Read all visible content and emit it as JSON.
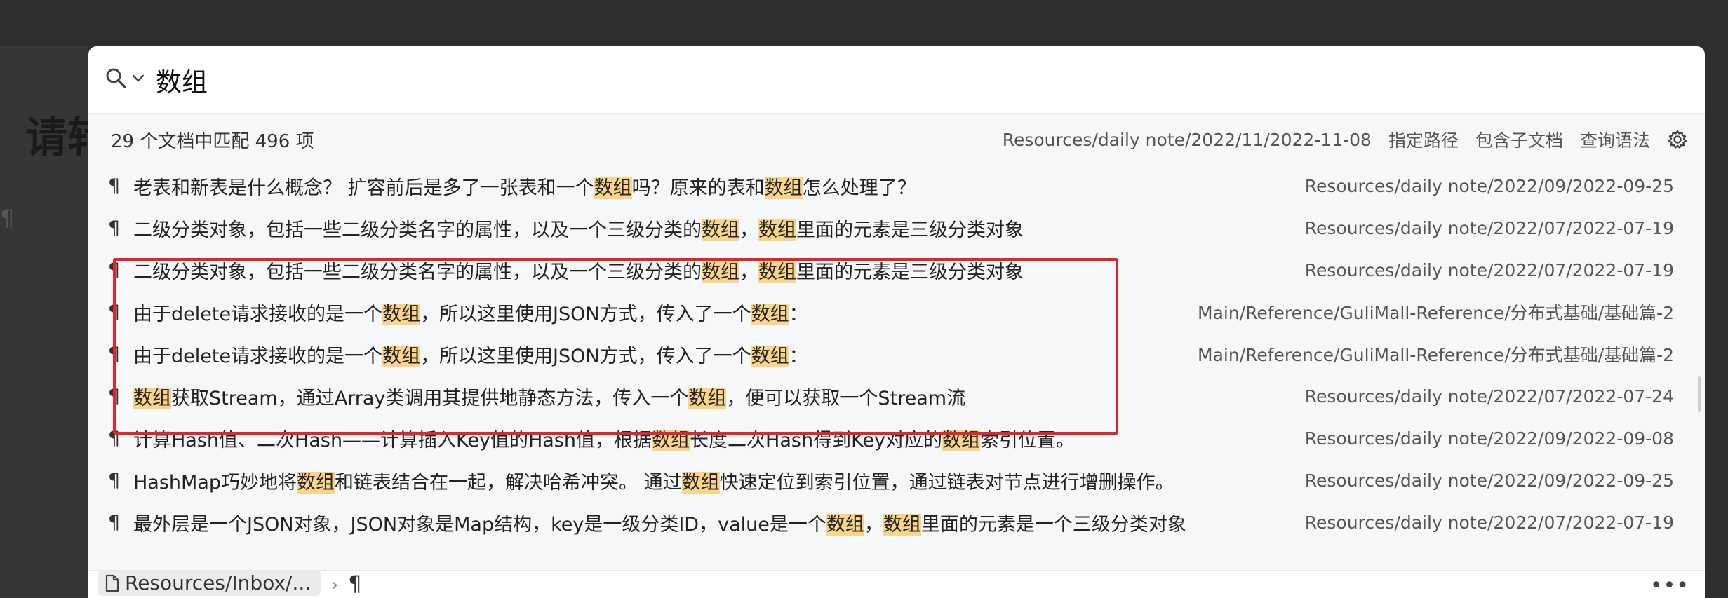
{
  "background": {
    "heading": "请转",
    "pilcrow": "¶"
  },
  "search": {
    "query": "数组"
  },
  "summary": {
    "count_text": "29 个文档中匹配 496 项",
    "current_path": "Resources/daily note/2022/11/2022-11-08",
    "opt_path": "指定路径",
    "opt_subdoc": "包含子文档",
    "opt_syntax": "查询语法"
  },
  "results": [
    {
      "parts": [
        "老表和新表是什么概念？ 扩容前后是多了一张表和一个",
        "*数组",
        "吗？原来的表和",
        "*数组",
        "怎么处理了？"
      ],
      "path": "Resources/daily note/2022/09/2022-09-25"
    },
    {
      "parts": [
        "二级分类对象，包括一些二级分类名字的属性，以及一个三级分类的",
        "*数组",
        "，",
        "*数组",
        "里面的元素是三级分类对象"
      ],
      "path": "Resources/daily note/2022/07/2022-07-19"
    },
    {
      "parts": [
        "二级分类对象，包括一些二级分类名字的属性，以及一个三级分类的",
        "*数组",
        "，",
        "*数组",
        "里面的元素是三级分类对象"
      ],
      "path": "Resources/daily note/2022/07/2022-07-19"
    },
    {
      "parts": [
        "由于delete请求接收的是一个",
        "*数组",
        "，所以这里使用JSON方式，传入了一个",
        "*数组",
        "："
      ],
      "path": "Main/Reference/GuliMall-Reference/分布式基础/基础篇-2"
    },
    {
      "parts": [
        "由于delete请求接收的是一个",
        "*数组",
        "，所以这里使用JSON方式，传入了一个",
        "*数组",
        "："
      ],
      "path": "Main/Reference/GuliMall-Reference/分布式基础/基础篇-2"
    },
    {
      "parts": [
        "*数组",
        "获取Stream，通过Array类调用其提供地静态方法，传入一个",
        "*数组",
        "，便可以获取一个Stream流"
      ],
      "path": "Resources/daily note/2022/07/2022-07-24"
    },
    {
      "parts": [
        "计算Hash值、二次Hash——计算插入Key值的Hash值，根据",
        "*数组",
        "长度二次Hash得到Key对应的",
        "*数组",
        "索引位置。"
      ],
      "path": "Resources/daily note/2022/09/2022-09-08"
    },
    {
      "parts": [
        "HashMap巧妙地将",
        "*数组",
        "和链表结合在一起，解决哈希冲突。 通过",
        "*数组",
        "快速定位到索引位置，通过链表对节点进行增删操作。"
      ],
      "path": "Resources/daily note/2022/09/2022-09-25"
    },
    {
      "parts": [
        "最外层是一个JSON对象，JSON对象是Map结构，key是一级分类ID，value是一个",
        "*数组",
        "，",
        "*数组",
        "里面的元素是一个三级分类对象"
      ],
      "path": "Resources/daily note/2022/07/2022-07-19"
    }
  ],
  "footer": {
    "breadcrumb": "Resources/Inbox/...",
    "chevron": "›",
    "pilcrow": "¶",
    "more": "•••"
  },
  "colors": {
    "highlight": "#f8d58a",
    "annotation_box": "#e0262d"
  }
}
